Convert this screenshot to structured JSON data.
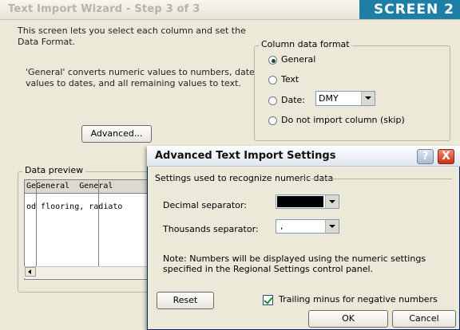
{
  "wizard": {
    "title": "Text Import Wizard - Step 3 of 3",
    "badge": "SCREEN 2",
    "intro": "This screen lets you select each column and set the Data Format.",
    "general_note": "'General' converts numeric values to numbers, date values to dates, and all remaining values to text.",
    "advanced_button": "Advanced...",
    "column_data_format": {
      "legend": "Column data format",
      "options": [
        {
          "label": "General",
          "selected": true
        },
        {
          "label": "Text",
          "selected": false
        },
        {
          "label": "Date:",
          "selected": false
        },
        {
          "label": "Do not import column (skip)",
          "selected": false
        }
      ],
      "date_value": "DMY"
    },
    "data_preview": {
      "legend": "Data preview",
      "header": "GeGeneral  General",
      "row": "od flooring, radiato"
    }
  },
  "advanced_dialog": {
    "title": "Advanced Text Import Settings",
    "help_icon": "?",
    "close_icon": "X",
    "group_label": "Settings used to recognize numeric data",
    "decimal_label": "Decimal separator:",
    "decimal_value": "",
    "thousands_label": "Thousands separator:",
    "thousands_value": ",",
    "note": "Note: Numbers will be displayed using the numeric settings specified in the Regional Settings control panel.",
    "reset_button": "Reset",
    "trailing_minus": {
      "label": "Trailing minus for negative numbers",
      "checked": true
    },
    "ok_button": "OK",
    "cancel_button": "Cancel"
  }
}
